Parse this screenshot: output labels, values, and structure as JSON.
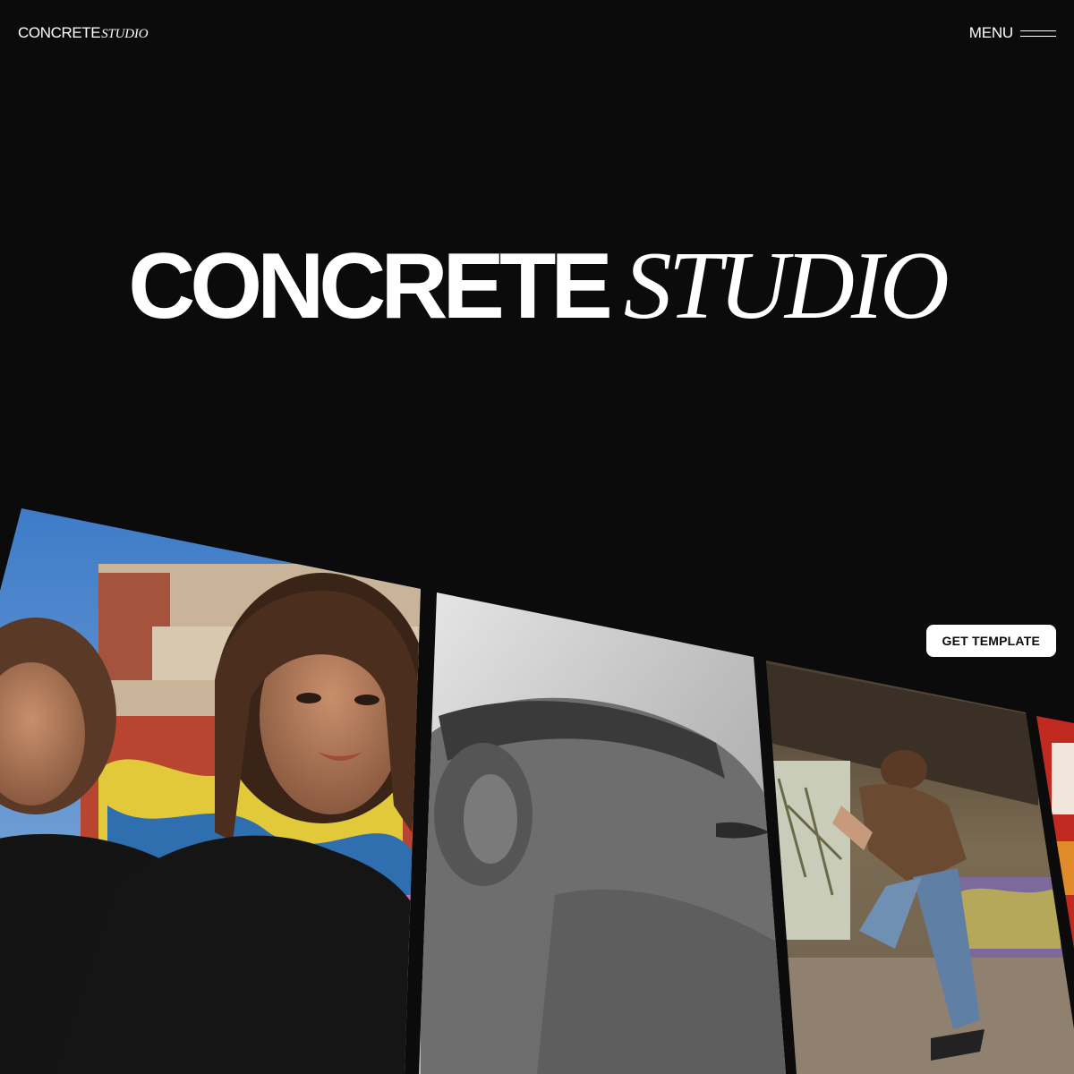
{
  "header": {
    "logo_main": "CONCRETE",
    "logo_script": "STUDIO",
    "menu_label": "MENU"
  },
  "hero": {
    "title_main": "CONCRETE",
    "title_script": "STUDIO"
  },
  "cta": {
    "label": "GET TEMPLATE"
  },
  "gallery": {
    "images": [
      {
        "subject": "two-models-graffiti-wall"
      },
      {
        "subject": "bw-closeup-profile"
      },
      {
        "subject": "skateboarder-under-bridge"
      },
      {
        "subject": "red-graffiti-partial"
      }
    ]
  },
  "colors": {
    "background": "#0b0b0b",
    "text": "#ffffff",
    "button_bg": "#ffffff",
    "button_text": "#0b0b0b"
  }
}
